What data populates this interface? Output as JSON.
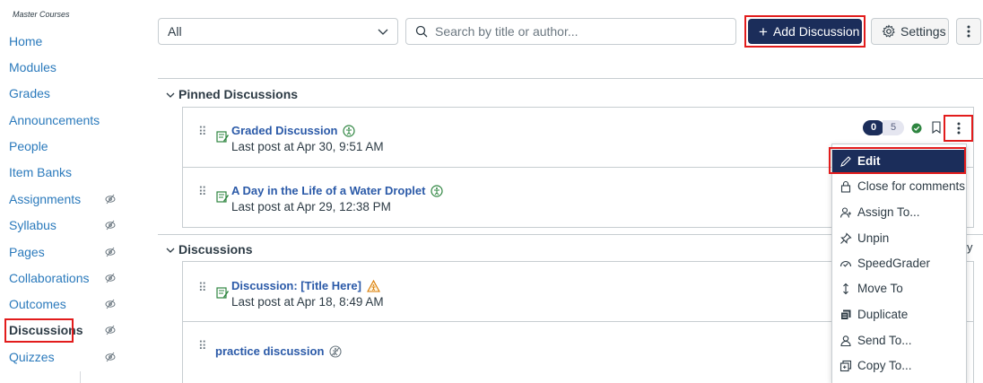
{
  "sidebar": {
    "course_label": "Master Courses",
    "items": [
      {
        "label": "Home",
        "hidden": false
      },
      {
        "label": "Modules",
        "hidden": false
      },
      {
        "label": "Grades",
        "hidden": false
      },
      {
        "label": "Announcements",
        "hidden": false
      },
      {
        "label": "People",
        "hidden": false
      },
      {
        "label": "Item Banks",
        "hidden": false
      },
      {
        "label": "Assignments",
        "hidden": true
      },
      {
        "label": "Syllabus",
        "hidden": true
      },
      {
        "label": "Pages",
        "hidden": true
      },
      {
        "label": "Collaborations",
        "hidden": true
      },
      {
        "label": "Outcomes",
        "hidden": true
      },
      {
        "label": "Discussions",
        "hidden": true,
        "active": true
      },
      {
        "label": "Quizzes",
        "hidden": true
      }
    ]
  },
  "toolbar": {
    "filter_value": "All",
    "search_placeholder": "Search by title or author...",
    "add_label": "Add Discussion",
    "settings_label": "Settings"
  },
  "pinned": {
    "header": "Pinned Discussions",
    "items": [
      {
        "title": "Graded Discussion",
        "last_post": "Last post at Apr 30, 9:51 AM",
        "unread": "0",
        "total": "5",
        "accessibility_status": "published"
      },
      {
        "title": "A Day in the Life of a Water Droplet",
        "last_post": "Last post at Apr 29, 12:38 PM",
        "accessibility_status": "published"
      }
    ]
  },
  "discussions": {
    "header": "Discussions",
    "items": [
      {
        "title": "Discussion: [Title Here]",
        "last_post": "Last post at Apr 18, 8:49 AM",
        "accessibility_status": "warning"
      },
      {
        "title": "practice discussion",
        "last_post": "",
        "accessibility_status": "unpublished"
      }
    ],
    "truncated_text": "y"
  },
  "menu": {
    "items": [
      {
        "label": "Edit",
        "icon": "pencil-icon",
        "selected": true
      },
      {
        "label": "Close for comments",
        "icon": "lock-icon"
      },
      {
        "label": "Assign To...",
        "icon": "assign-icon"
      },
      {
        "label": "Unpin",
        "icon": "pin-icon"
      },
      {
        "label": "SpeedGrader",
        "icon": "speedgrader-icon"
      },
      {
        "label": "Move To",
        "icon": "move-icon"
      },
      {
        "label": "Duplicate",
        "icon": "duplicate-icon"
      },
      {
        "label": "Send To...",
        "icon": "send-icon"
      },
      {
        "label": "Copy To...",
        "icon": "copy-icon"
      }
    ]
  },
  "colors": {
    "link": "#2b7abc",
    "primary_button": "#1b2d5a",
    "highlight": "#e21c1c",
    "published_green": "#2e8540",
    "warning_orange": "#d97a00"
  }
}
